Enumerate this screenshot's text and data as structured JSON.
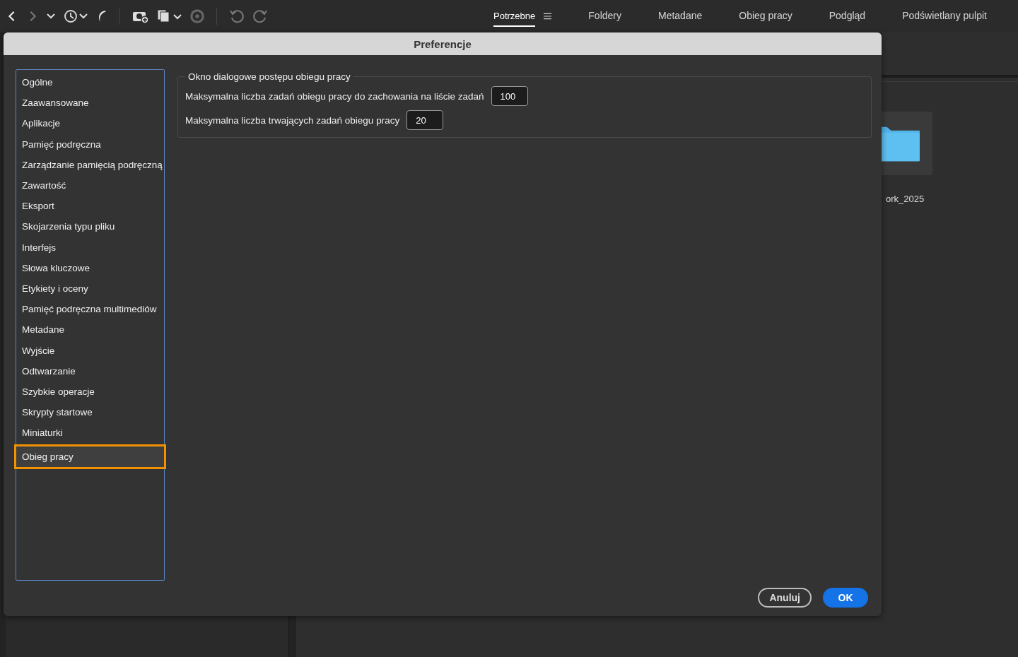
{
  "workspace_tabs": [
    {
      "label": "Potrzebne",
      "selected": true
    },
    {
      "label": "Foldery",
      "selected": false
    },
    {
      "label": "Metadane",
      "selected": false
    },
    {
      "label": "Obieg pracy",
      "selected": false
    },
    {
      "label": "Podgląd",
      "selected": false
    },
    {
      "label": "Podświetlany pulpit",
      "selected": false
    }
  ],
  "content": {
    "folder_label": "ork_2025"
  },
  "dialog": {
    "title": "Preferencje",
    "sidebar": {
      "items": [
        {
          "label": "Ogólne",
          "selected": false
        },
        {
          "label": "Zaawansowane",
          "selected": false
        },
        {
          "label": "Aplikacje",
          "selected": false
        },
        {
          "label": "Pamięć podręczna",
          "selected": false
        },
        {
          "label": "Zarządzanie pamięcią podręczną",
          "selected": false
        },
        {
          "label": "Zawartość",
          "selected": false
        },
        {
          "label": "Eksport",
          "selected": false
        },
        {
          "label": "Skojarzenia typu pliku",
          "selected": false
        },
        {
          "label": "Interfejs",
          "selected": false
        },
        {
          "label": "Słowa kluczowe",
          "selected": false
        },
        {
          "label": "Etykiety i oceny",
          "selected": false
        },
        {
          "label": "Pamięć podręczna multimediów",
          "selected": false
        },
        {
          "label": "Metadane",
          "selected": false
        },
        {
          "label": "Wyjście",
          "selected": false
        },
        {
          "label": "Odtwarzanie",
          "selected": false
        },
        {
          "label": "Szybkie operacje",
          "selected": false
        },
        {
          "label": "Skrypty startowe",
          "selected": false
        },
        {
          "label": "Miniaturki",
          "selected": false
        },
        {
          "label": "Obieg pracy",
          "selected": true
        }
      ]
    },
    "group": {
      "title": "Okno dialogowe postępu obiegu pracy",
      "fields": [
        {
          "label": "Maksymalna liczba zadań obiegu pracy do zachowania na liście zadań",
          "value": "100"
        },
        {
          "label": "Maksymalna liczba trwających zadań obiegu pracy",
          "value": "20"
        }
      ]
    },
    "buttons": [
      {
        "kind": "secondary",
        "label": "Anuluj"
      },
      {
        "kind": "primary",
        "label": "OK"
      }
    ]
  }
}
